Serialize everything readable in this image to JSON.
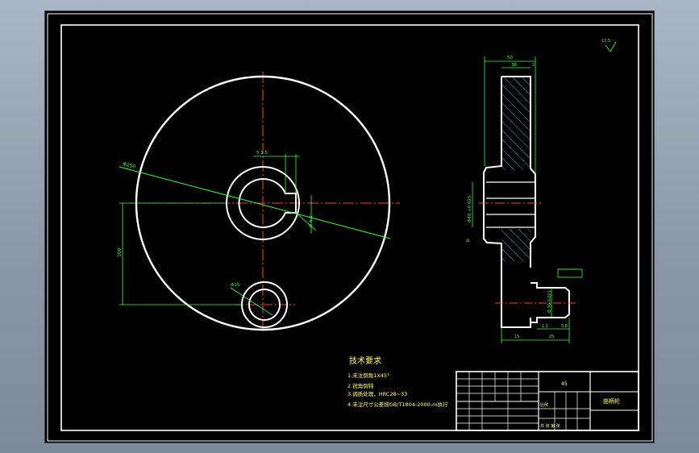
{
  "colors": {
    "outline": "#ffffff",
    "centerline": "#ff3b3b",
    "dimension": "#33ff33",
    "hatch": "#4aa3d8",
    "notes": "#ffff66"
  },
  "dimensions": {
    "outer_diameter": "Φ250",
    "keyway_width": "5 1.5",
    "keyway_depth": "7.5",
    "hub_bore": "Φ 6.5",
    "pin_offset": "100",
    "pin_hole": "Φ15",
    "side_width_total": "50",
    "side_width_rim": "38",
    "side_edge": "2",
    "hub_bore_tol": "Φ40 +0.025",
    "boss_diameter": "Φ 30 0.021",
    "boss_length": "15",
    "boss_web": "25",
    "boss_step_a": "1.2",
    "boss_step_b": "5.8",
    "surface_roughness": "12.5"
  },
  "technical_requirements": {
    "title": "技术要求",
    "items": [
      "1.未注倒角1X45°",
      "2.锐角倒钝",
      "3.调质处理，HRC28~33",
      "4.未注尺寸公差按GB/T1804-2000-m执行"
    ]
  },
  "title_block": {
    "part_name": "曲柄轮",
    "material": "45",
    "scale_label": "比例",
    "sheet_label": "共 张 第 张"
  }
}
